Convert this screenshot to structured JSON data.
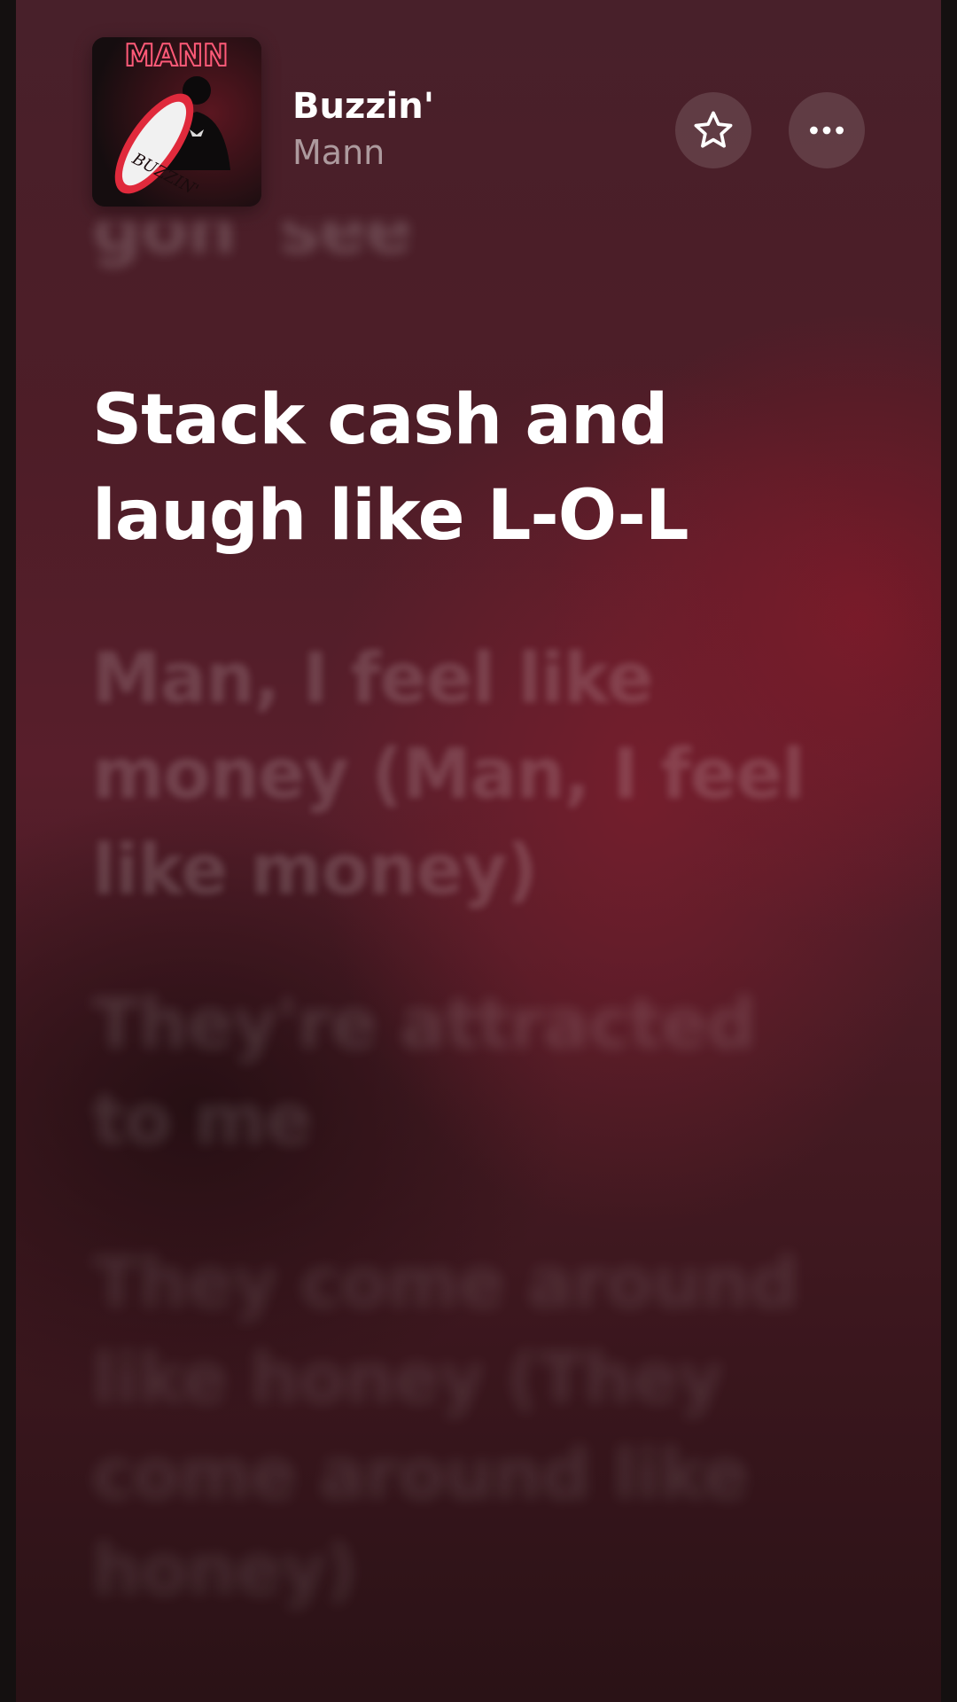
{
  "now_playing": {
    "artwork_alt_text": "MANN",
    "artwork_logo_text": "MANN",
    "artwork_script_text": "BUZZIN'",
    "title": "Buzzin'",
    "artist": "Mann",
    "favorite_icon": "star-icon",
    "more_icon": "ellipsis-icon"
  },
  "lyrics": {
    "previous_line": "gon' see",
    "active_line": "Stack cash and laugh like L-O-L",
    "upcoming_lines": [
      "Man, I feel like money (Man, I feel like money)",
      "They're attracted to me",
      "They come around like honey (They come around like honey)"
    ]
  },
  "colors": {
    "background_top": "#48202a",
    "background_bottom": "#2a1216",
    "active_lyric": "#ffffff",
    "artwork_accent": "#e02a3c"
  }
}
